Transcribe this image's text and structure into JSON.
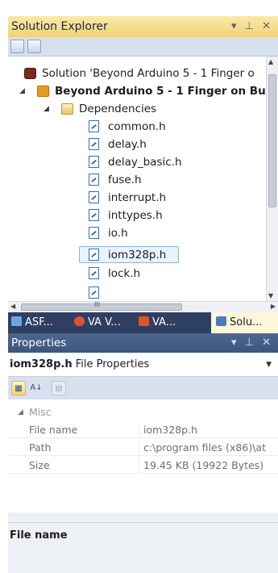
{
  "solution_explorer": {
    "title": "Solution Explorer",
    "controls": "▾ ⊥ ✕",
    "tree": [
      {
        "text": "Solution 'Beyond Arduino 5 - 1 Finger o",
        "kind": "solution",
        "bold": false
      },
      {
        "text": "Beyond Arduino 5 - 1 Finger on Bu",
        "kind": "project",
        "bold": true
      },
      {
        "text": "Dependencies",
        "kind": "folder",
        "bold": false
      },
      {
        "text": "common.h",
        "kind": "file",
        "bold": false
      },
      {
        "text": "delay.h",
        "kind": "file",
        "bold": false
      },
      {
        "text": "delay_basic.h",
        "kind": "file",
        "bold": false
      },
      {
        "text": "fuse.h",
        "kind": "file",
        "bold": false
      },
      {
        "text": "interrupt.h",
        "kind": "file",
        "bold": false
      },
      {
        "text": "inttypes.h",
        "kind": "file",
        "bold": false
      },
      {
        "text": "io.h",
        "kind": "file",
        "bold": false
      },
      {
        "text": "iom328p.h",
        "kind": "file",
        "bold": false
      },
      {
        "text": "lock.h",
        "kind": "file",
        "bold": false
      }
    ],
    "selected_item": "iom328p.h",
    "hscroll_mid": "III"
  },
  "tool_tabs": [
    {
      "label": "ASF...",
      "icon": "asf-icon",
      "color": "#6aa6e6"
    },
    {
      "label": "VA V...",
      "icon": "va-view-icon",
      "color": "#e0532a"
    },
    {
      "label": "VA...",
      "icon": "va-outline-icon",
      "color": "#e0532a"
    },
    {
      "label": "Solu...",
      "icon": "solution-explorer-icon",
      "color": "#4a7cc0"
    }
  ],
  "properties": {
    "title": "Properties",
    "controls": "▾ ⊥ ✕",
    "object_name": "iom328p.h",
    "object_type": "File Properties",
    "category": "Misc",
    "rows": [
      {
        "key": "File name",
        "value": "iom328p.h"
      },
      {
        "key": "Path",
        "value": "c:\\program files (x86)\\at"
      },
      {
        "key": "Size",
        "value": "19.45 KB (19922 Bytes)"
      }
    ],
    "description_title": "File name"
  }
}
